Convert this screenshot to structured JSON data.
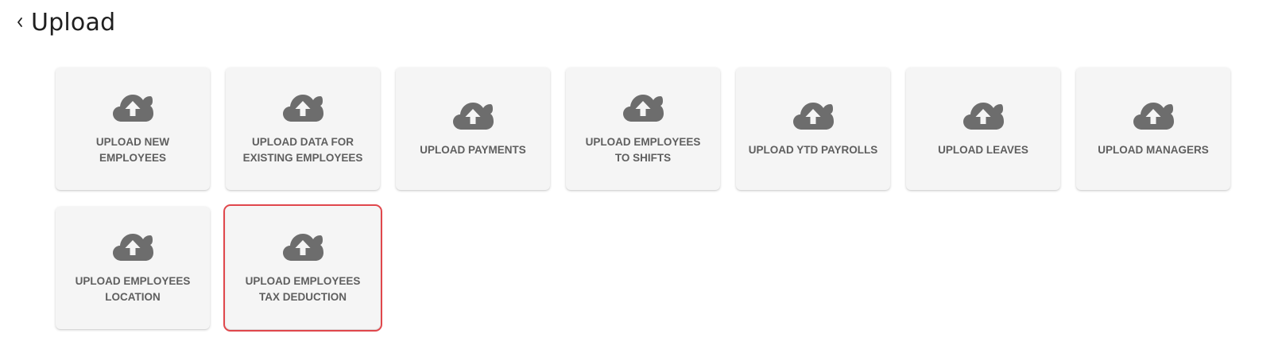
{
  "header": {
    "title": "Upload",
    "back_icon": "chevron-left-icon"
  },
  "cards": [
    {
      "label": "UPLOAD NEW EMPLOYEES",
      "icon": "cloud-upload-icon"
    },
    {
      "label": "UPLOAD DATA FOR EXISTING EMPLOYEES",
      "icon": "cloud-upload-icon"
    },
    {
      "label": "UPLOAD PAYMENTS",
      "icon": "cloud-upload-icon"
    },
    {
      "label": "UPLOAD EMPLOYEES TO SHIFTS",
      "icon": "cloud-upload-icon"
    },
    {
      "label": "UPLOAD YTD PAYROLLS",
      "icon": "cloud-upload-icon"
    },
    {
      "label": "UPLOAD LEAVES",
      "icon": "cloud-upload-icon"
    },
    {
      "label": "UPLOAD MANAGERS",
      "icon": "cloud-upload-icon"
    },
    {
      "label": "UPLOAD EMPLOYEES LOCATION",
      "icon": "cloud-upload-icon"
    },
    {
      "label": "UPLOAD EMPLOYEES TAX DEDUCTION",
      "icon": "cloud-upload-icon",
      "highlighted": true
    }
  ],
  "colors": {
    "card_background": "#f5f5f5",
    "icon": "#6d6d6d",
    "label": "#5f5f5f",
    "highlight_border": "#e0474c"
  }
}
